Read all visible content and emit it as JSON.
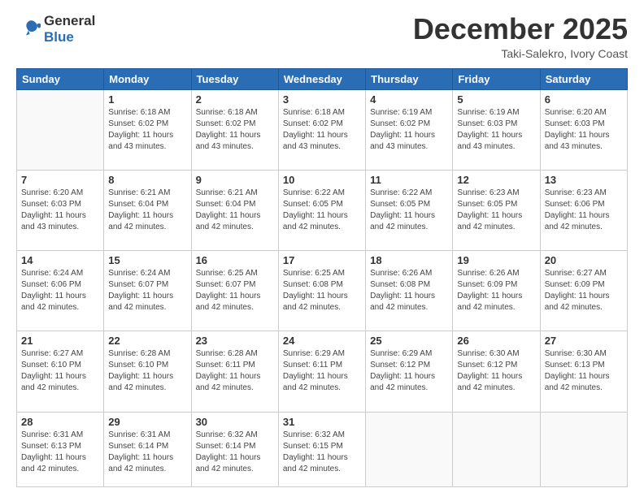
{
  "header": {
    "logo_line1": "General",
    "logo_line2": "Blue",
    "month": "December 2025",
    "location": "Taki-Salekro, Ivory Coast"
  },
  "weekdays": [
    "Sunday",
    "Monday",
    "Tuesday",
    "Wednesday",
    "Thursday",
    "Friday",
    "Saturday"
  ],
  "weeks": [
    [
      {
        "day": "",
        "info": ""
      },
      {
        "day": "1",
        "info": "Sunrise: 6:18 AM\nSunset: 6:02 PM\nDaylight: 11 hours\nand 43 minutes."
      },
      {
        "day": "2",
        "info": "Sunrise: 6:18 AM\nSunset: 6:02 PM\nDaylight: 11 hours\nand 43 minutes."
      },
      {
        "day": "3",
        "info": "Sunrise: 6:18 AM\nSunset: 6:02 PM\nDaylight: 11 hours\nand 43 minutes."
      },
      {
        "day": "4",
        "info": "Sunrise: 6:19 AM\nSunset: 6:02 PM\nDaylight: 11 hours\nand 43 minutes."
      },
      {
        "day": "5",
        "info": "Sunrise: 6:19 AM\nSunset: 6:03 PM\nDaylight: 11 hours\nand 43 minutes."
      },
      {
        "day": "6",
        "info": "Sunrise: 6:20 AM\nSunset: 6:03 PM\nDaylight: 11 hours\nand 43 minutes."
      }
    ],
    [
      {
        "day": "7",
        "info": "Sunrise: 6:20 AM\nSunset: 6:03 PM\nDaylight: 11 hours\nand 43 minutes."
      },
      {
        "day": "8",
        "info": "Sunrise: 6:21 AM\nSunset: 6:04 PM\nDaylight: 11 hours\nand 42 minutes."
      },
      {
        "day": "9",
        "info": "Sunrise: 6:21 AM\nSunset: 6:04 PM\nDaylight: 11 hours\nand 42 minutes."
      },
      {
        "day": "10",
        "info": "Sunrise: 6:22 AM\nSunset: 6:05 PM\nDaylight: 11 hours\nand 42 minutes."
      },
      {
        "day": "11",
        "info": "Sunrise: 6:22 AM\nSunset: 6:05 PM\nDaylight: 11 hours\nand 42 minutes."
      },
      {
        "day": "12",
        "info": "Sunrise: 6:23 AM\nSunset: 6:05 PM\nDaylight: 11 hours\nand 42 minutes."
      },
      {
        "day": "13",
        "info": "Sunrise: 6:23 AM\nSunset: 6:06 PM\nDaylight: 11 hours\nand 42 minutes."
      }
    ],
    [
      {
        "day": "14",
        "info": "Sunrise: 6:24 AM\nSunset: 6:06 PM\nDaylight: 11 hours\nand 42 minutes."
      },
      {
        "day": "15",
        "info": "Sunrise: 6:24 AM\nSunset: 6:07 PM\nDaylight: 11 hours\nand 42 minutes."
      },
      {
        "day": "16",
        "info": "Sunrise: 6:25 AM\nSunset: 6:07 PM\nDaylight: 11 hours\nand 42 minutes."
      },
      {
        "day": "17",
        "info": "Sunrise: 6:25 AM\nSunset: 6:08 PM\nDaylight: 11 hours\nand 42 minutes."
      },
      {
        "day": "18",
        "info": "Sunrise: 6:26 AM\nSunset: 6:08 PM\nDaylight: 11 hours\nand 42 minutes."
      },
      {
        "day": "19",
        "info": "Sunrise: 6:26 AM\nSunset: 6:09 PM\nDaylight: 11 hours\nand 42 minutes."
      },
      {
        "day": "20",
        "info": "Sunrise: 6:27 AM\nSunset: 6:09 PM\nDaylight: 11 hours\nand 42 minutes."
      }
    ],
    [
      {
        "day": "21",
        "info": "Sunrise: 6:27 AM\nSunset: 6:10 PM\nDaylight: 11 hours\nand 42 minutes."
      },
      {
        "day": "22",
        "info": "Sunrise: 6:28 AM\nSunset: 6:10 PM\nDaylight: 11 hours\nand 42 minutes."
      },
      {
        "day": "23",
        "info": "Sunrise: 6:28 AM\nSunset: 6:11 PM\nDaylight: 11 hours\nand 42 minutes."
      },
      {
        "day": "24",
        "info": "Sunrise: 6:29 AM\nSunset: 6:11 PM\nDaylight: 11 hours\nand 42 minutes."
      },
      {
        "day": "25",
        "info": "Sunrise: 6:29 AM\nSunset: 6:12 PM\nDaylight: 11 hours\nand 42 minutes."
      },
      {
        "day": "26",
        "info": "Sunrise: 6:30 AM\nSunset: 6:12 PM\nDaylight: 11 hours\nand 42 minutes."
      },
      {
        "day": "27",
        "info": "Sunrise: 6:30 AM\nSunset: 6:13 PM\nDaylight: 11 hours\nand 42 minutes."
      }
    ],
    [
      {
        "day": "28",
        "info": "Sunrise: 6:31 AM\nSunset: 6:13 PM\nDaylight: 11 hours\nand 42 minutes."
      },
      {
        "day": "29",
        "info": "Sunrise: 6:31 AM\nSunset: 6:14 PM\nDaylight: 11 hours\nand 42 minutes."
      },
      {
        "day": "30",
        "info": "Sunrise: 6:32 AM\nSunset: 6:14 PM\nDaylight: 11 hours\nand 42 minutes."
      },
      {
        "day": "31",
        "info": "Sunrise: 6:32 AM\nSunset: 6:15 PM\nDaylight: 11 hours\nand 42 minutes."
      },
      {
        "day": "",
        "info": ""
      },
      {
        "day": "",
        "info": ""
      },
      {
        "day": "",
        "info": ""
      }
    ]
  ]
}
